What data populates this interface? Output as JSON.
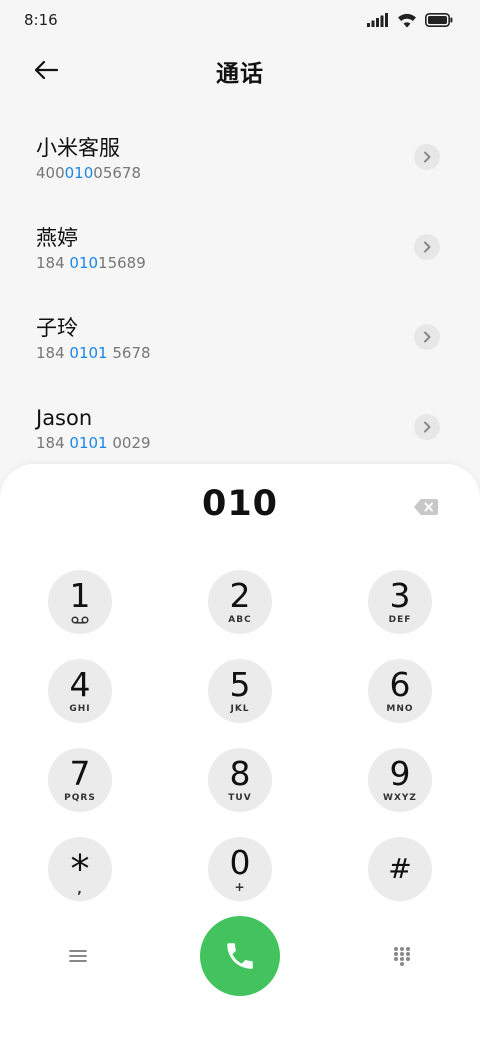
{
  "status_bar": {
    "time": "8:16",
    "icons": [
      "signal-icon",
      "wifi-icon",
      "battery-icon"
    ]
  },
  "header": {
    "title": "通话",
    "back_icon": "arrow-left-icon"
  },
  "contacts": [
    {
      "name": "小米客服",
      "number_parts": [
        "400",
        "010",
        "05678"
      ]
    },
    {
      "name": "燕婷",
      "number_parts": [
        "184 ",
        "010",
        "15689"
      ]
    },
    {
      "name": "子玲",
      "number_parts": [
        "184 ",
        "0101",
        " 5678"
      ]
    },
    {
      "name": "Jason",
      "number_parts": [
        "184 ",
        "0101",
        " 0029"
      ]
    }
  ],
  "dialer": {
    "typed_number": "010",
    "keys": [
      {
        "digit": "1",
        "letters": ""
      },
      {
        "digit": "2",
        "letters": "ABC"
      },
      {
        "digit": "3",
        "letters": "DEF"
      },
      {
        "digit": "4",
        "letters": "GHI"
      },
      {
        "digit": "5",
        "letters": "JKL"
      },
      {
        "digit": "6",
        "letters": "MNO"
      },
      {
        "digit": "7",
        "letters": "PQRS"
      },
      {
        "digit": "8",
        "letters": "TUV"
      },
      {
        "digit": "9",
        "letters": "WXYZ"
      },
      {
        "digit": "*",
        "letters": ","
      },
      {
        "digit": "0",
        "letters": "+"
      },
      {
        "digit": "#",
        "letters": ""
      }
    ]
  },
  "colors": {
    "highlight": "#1a86e8",
    "call_button": "#43c35e",
    "key_background": "#ebebeb",
    "page_background": "#f6f6f6"
  }
}
